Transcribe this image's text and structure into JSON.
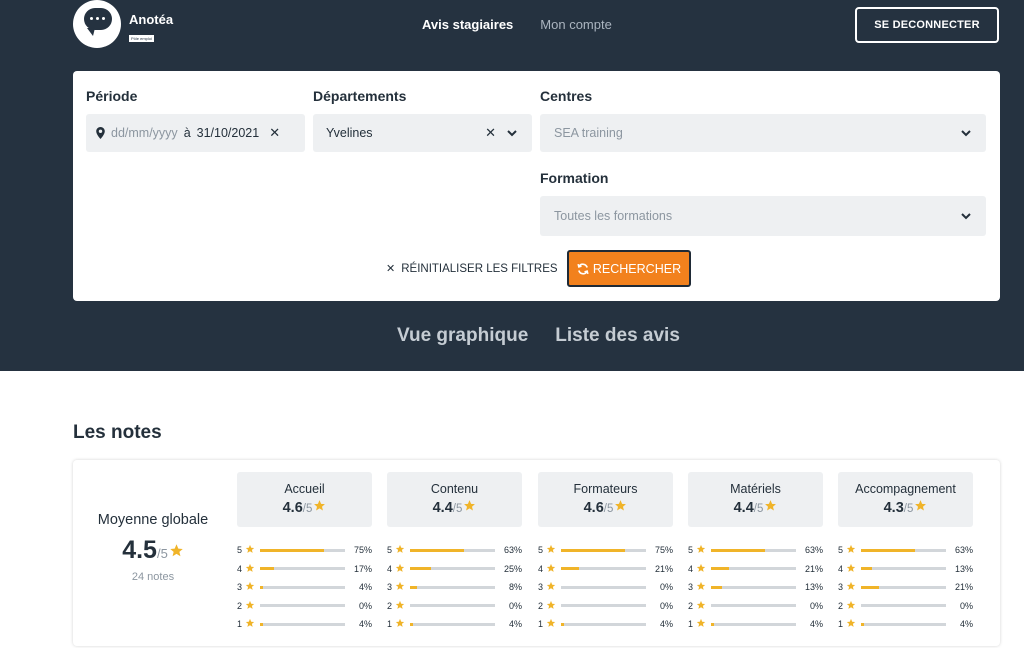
{
  "brand": {
    "name": "Anotéa",
    "tagline": "Pôle emploi"
  },
  "nav": {
    "active": "Avis stagiaires",
    "link": "Mon compte"
  },
  "logout_label": "SE DECONNECTER",
  "filters": {
    "periode": {
      "label": "Période",
      "start_placeholder": "dd/mm/yyyy",
      "separator": "à",
      "end_value": "31/10/2021"
    },
    "departements": {
      "label": "Départements",
      "value": "Yvelines"
    },
    "centres": {
      "label": "Centres",
      "value": "SEA training"
    },
    "formation": {
      "label": "Formation",
      "value": "Toutes les formations"
    },
    "reset_label": "RÉINITIALISER LES FILTRES",
    "search_label": "RECHERCHER"
  },
  "views": {
    "graph": "Vue graphique",
    "list": "Liste des avis"
  },
  "notes": {
    "title": "Les notes",
    "global": {
      "label": "Moyenne globale",
      "score": "4.5",
      "max": "/5",
      "count": "24 notes"
    },
    "categories": [
      {
        "name": "Accueil",
        "score": "4.6",
        "max": "/5",
        "rows": [
          {
            "stars": "5",
            "pct": "75%",
            "value": 75
          },
          {
            "stars": "4",
            "pct": "17%",
            "value": 17
          },
          {
            "stars": "3",
            "pct": "4%",
            "value": 4
          },
          {
            "stars": "2",
            "pct": "0%",
            "value": 0
          },
          {
            "stars": "1",
            "pct": "4%",
            "value": 4
          }
        ]
      },
      {
        "name": "Contenu",
        "score": "4.4",
        "max": "/5",
        "rows": [
          {
            "stars": "5",
            "pct": "63%",
            "value": 63
          },
          {
            "stars": "4",
            "pct": "25%",
            "value": 25
          },
          {
            "stars": "3",
            "pct": "8%",
            "value": 8
          },
          {
            "stars": "2",
            "pct": "0%",
            "value": 0
          },
          {
            "stars": "1",
            "pct": "4%",
            "value": 4
          }
        ]
      },
      {
        "name": "Formateurs",
        "score": "4.6",
        "max": "/5",
        "rows": [
          {
            "stars": "5",
            "pct": "75%",
            "value": 75
          },
          {
            "stars": "4",
            "pct": "21%",
            "value": 21
          },
          {
            "stars": "3",
            "pct": "0%",
            "value": 0
          },
          {
            "stars": "2",
            "pct": "0%",
            "value": 0
          },
          {
            "stars": "1",
            "pct": "4%",
            "value": 4
          }
        ]
      },
      {
        "name": "Matériels",
        "score": "4.4",
        "max": "/5",
        "rows": [
          {
            "stars": "5",
            "pct": "63%",
            "value": 63
          },
          {
            "stars": "4",
            "pct": "21%",
            "value": 21
          },
          {
            "stars": "3",
            "pct": "13%",
            "value": 13
          },
          {
            "stars": "2",
            "pct": "0%",
            "value": 0
          },
          {
            "stars": "1",
            "pct": "4%",
            "value": 4
          }
        ]
      },
      {
        "name": "Accompagnement",
        "score": "4.3",
        "max": "/5",
        "rows": [
          {
            "stars": "5",
            "pct": "63%",
            "value": 63
          },
          {
            "stars": "4",
            "pct": "13%",
            "value": 13
          },
          {
            "stars": "3",
            "pct": "21%",
            "value": 21
          },
          {
            "stars": "2",
            "pct": "0%",
            "value": 0
          },
          {
            "stars": "1",
            "pct": "4%",
            "value": 4
          }
        ]
      }
    ]
  },
  "colors": {
    "header_bg": "#253240",
    "accent_orange": "#f2811d",
    "star_yellow": "#f0b429",
    "field_bg": "#eef0f2"
  },
  "icons": {
    "star": "star-icon",
    "marker": "map-marker-icon",
    "close": "close-icon",
    "chevron": "chevron-down-icon",
    "refresh": "refresh-icon"
  }
}
